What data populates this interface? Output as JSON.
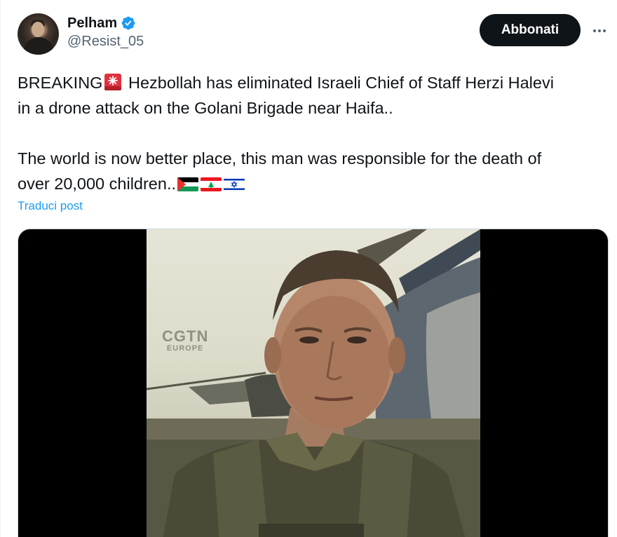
{
  "author": {
    "display_name": "Pelham",
    "handle": "@Resist_05",
    "verified": true,
    "avatar_alt": "profile-photo"
  },
  "actions": {
    "follow_label": "Abbonati",
    "more_icon": "more-horizontal-icon"
  },
  "tweet": {
    "line1_pre": "BREAKING",
    "line1_post": " Hezbollah has eliminated Israeli Chief of Staff Herzi Halevi",
    "line2": "in a drone attack on the Golani Brigade near Haifa..",
    "line3": "The world is now better place, this man was responsible for the death of",
    "line4": "over 20,000 children..",
    "emoji_alarm": "rotating-light-emoji",
    "flags": [
      "palestine-flag",
      "lebanon-flag",
      "israel-flag"
    ]
  },
  "translate_label": "Traduci post",
  "media": {
    "type": "video",
    "watermark_main": "CGTN",
    "watermark_sub": "EUROPE"
  },
  "colors": {
    "accent": "#1d9bf0",
    "text": "#0f1419",
    "secondary": "#536471",
    "button_bg": "#0f1419"
  }
}
